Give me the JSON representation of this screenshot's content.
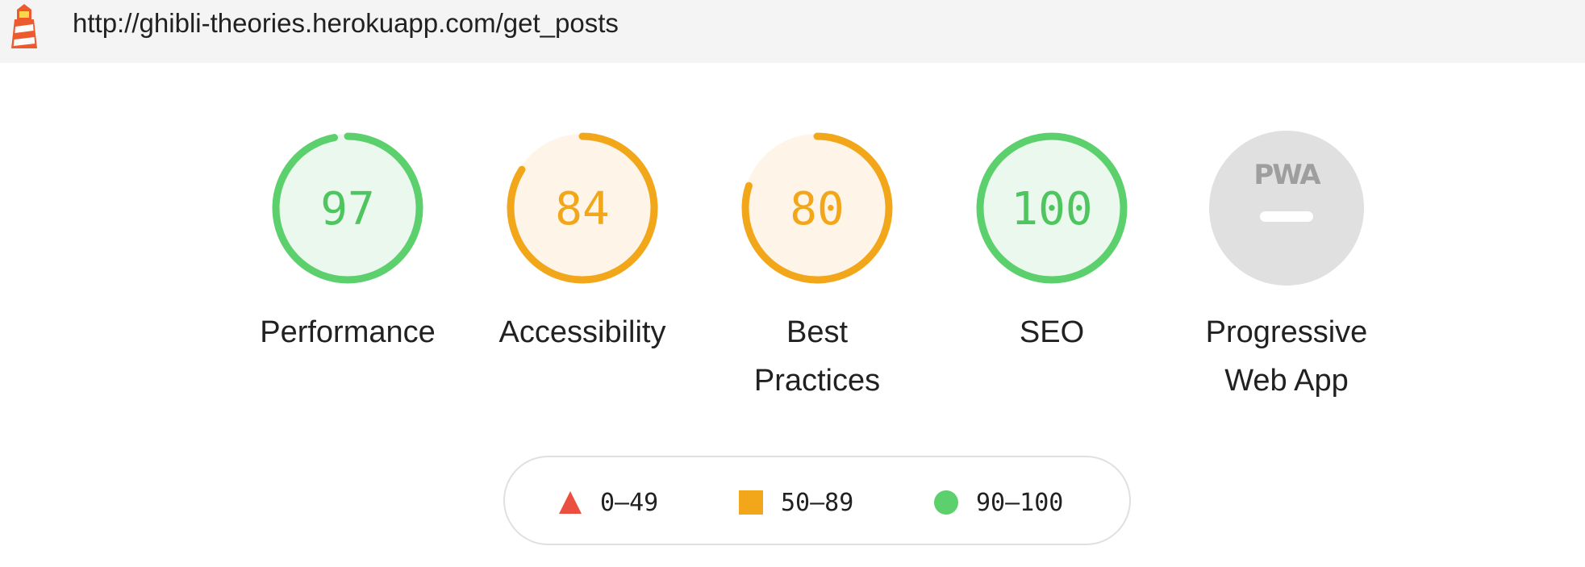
{
  "header": {
    "url": "http://ghibli-theories.herokuapp.com/get_posts",
    "logo_icon": "lighthouse-icon"
  },
  "gauges": [
    {
      "id": "performance",
      "score": 97,
      "label_lines": [
        "Performance"
      ],
      "rating": "pass"
    },
    {
      "id": "accessibility",
      "score": 84,
      "label_lines": [
        "Accessibility"
      ],
      "rating": "average"
    },
    {
      "id": "best-practices",
      "score": 80,
      "label_lines": [
        "Best",
        "Practices"
      ],
      "rating": "average"
    },
    {
      "id": "seo",
      "score": 100,
      "label_lines": [
        "SEO"
      ],
      "rating": "pass"
    },
    {
      "id": "pwa",
      "badge_text": "PWA",
      "label_lines": [
        "Progressive",
        "Web App"
      ],
      "rating": "na"
    }
  ],
  "legend": {
    "items": [
      {
        "shape": "triangle",
        "label": "0–49",
        "color": "#eb4f3f"
      },
      {
        "shape": "square",
        "label": "50–89",
        "color": "#f2a61a"
      },
      {
        "shape": "circle",
        "label": "90–100",
        "color": "#5dd06e"
      }
    ]
  },
  "colors": {
    "pass": "#5dd06e",
    "pass_text": "#4ec55f",
    "pass_bg": "#eaf8ed",
    "average": "#f2a61a",
    "average_text": "#f2a61a",
    "average_bg": "#fef5e8",
    "fail": "#eb4f3f",
    "na_bg": "#e0e0e0",
    "na_text": "#9e9e9e"
  }
}
